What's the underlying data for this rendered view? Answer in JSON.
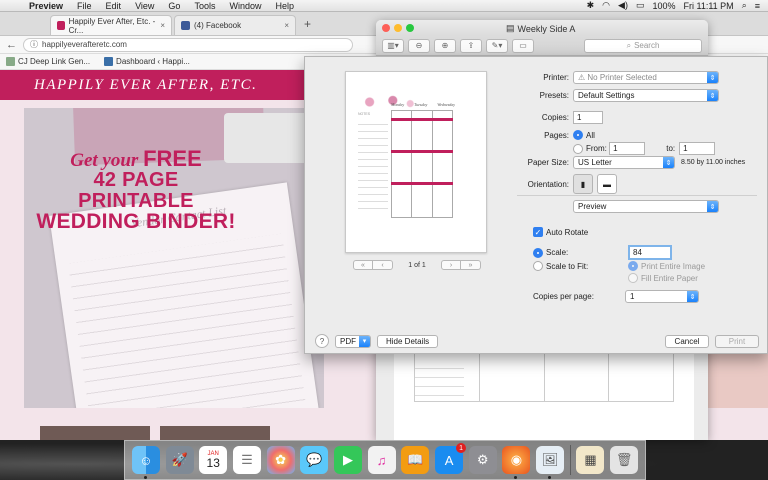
{
  "menubar": {
    "app_name": "Preview",
    "items": [
      "File",
      "Edit",
      "View",
      "Go",
      "Tools",
      "Window",
      "Help"
    ],
    "battery": "100%",
    "clock": "Fri 11:11 PM"
  },
  "browser": {
    "tabs": [
      {
        "label": "Happily Ever After, Etc. - Cr...",
        "active": true
      },
      {
        "label": "(4) Facebook",
        "active": false
      }
    ],
    "new_tab": "+",
    "url": "happilyeverafteretc.com",
    "bookmarks": [
      "CJ Deep Link Gen...",
      "Dashboard ‹ Happi..."
    ]
  },
  "site": {
    "header": "HAPPILY EVER AFTER, ETC.",
    "hero_line1_script": "Get your",
    "hero_line1_bold": "FREE",
    "hero_line2": "42 PAGE PRINTABLE",
    "hero_line3": "WEDDING BINDER!",
    "paper_heading": "Vendor Contact List"
  },
  "document_window": {
    "title": "Weekly Side A",
    "search_placeholder": "Search"
  },
  "print_dialog": {
    "preview": {
      "column_heads": [
        "Monday",
        "Tuesday",
        "Wednesday"
      ],
      "notes_label": "NOTES",
      "page_indicator": "1 of 1",
      "first_label": "«",
      "prev_label": "‹",
      "next_label": "›",
      "last_label": "»"
    },
    "printer_label": "Printer:",
    "printer_value": "No Printer Selected",
    "presets_label": "Presets:",
    "presets_value": "Default Settings",
    "copies_label": "Copies:",
    "copies_value": "1",
    "pages_label": "Pages:",
    "pages_all": "All",
    "pages_from_label": "From:",
    "pages_from": "1",
    "pages_to_label": "to:",
    "pages_to": "1",
    "paper_size_label": "Paper Size:",
    "paper_size_value": "US Letter",
    "paper_size_dims": "8.50 by 11.00 inches",
    "orientation_label": "Orientation:",
    "section_value": "Preview",
    "auto_rotate": "Auto Rotate",
    "scale_label": "Scale:",
    "scale_value": "84",
    "scale_to_fit": "Scale to Fit:",
    "print_entire_image": "Print Entire Image",
    "fill_entire_paper": "Fill Entire Paper",
    "copies_per_page_label": "Copies per page:",
    "copies_per_page_value": "1",
    "help": "?",
    "pdf_button": "PDF",
    "hide_details": "Hide Details",
    "cancel": "Cancel",
    "print": "Print"
  },
  "dock": {
    "apps": [
      "Finder",
      "Launchpad",
      "Calendar",
      "Reminders",
      "Photos",
      "Messages",
      "FaceTime",
      "iTunes",
      "iBooks",
      "App Store",
      "System Preferences",
      "Firefox",
      "Preview",
      "Downloads",
      "Trash"
    ],
    "calendar_month": "JAN",
    "calendar_day": "13",
    "appstore_badge": "1"
  },
  "colors": {
    "brand": "#c01f5c",
    "accent_blue": "#2f7ff0"
  }
}
